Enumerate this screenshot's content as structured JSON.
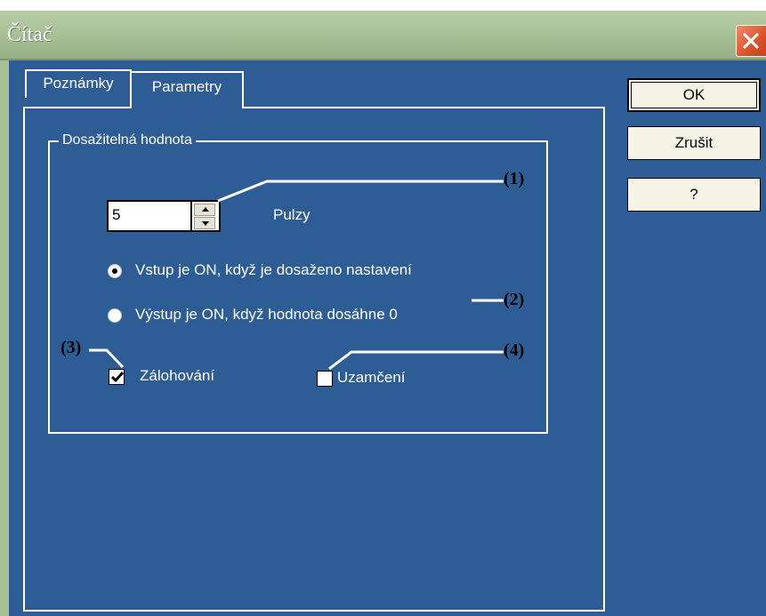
{
  "window": {
    "title": "Čítač"
  },
  "tabs": [
    {
      "label": "Poznámky",
      "active": false
    },
    {
      "label": "Parametry",
      "active": true
    }
  ],
  "group": {
    "label": "Dosažitelná hodnota"
  },
  "counter": {
    "value": "5",
    "unit_label": "Pulzy"
  },
  "radios": [
    {
      "label": "Vstup je ON, když je dosaženo nastavení",
      "checked": true
    },
    {
      "label": "Výstup je ON, když hodnota dosáhne 0",
      "checked": false
    }
  ],
  "checkboxes": [
    {
      "label": "Zálohování",
      "checked": true
    },
    {
      "label": "Uzamčení",
      "checked": false
    }
  ],
  "callouts": [
    "(1)",
    "(2)",
    "(3)",
    "(4)"
  ],
  "buttons": {
    "ok": "OK",
    "cancel": "Zrušit",
    "help": "?"
  },
  "colors": {
    "panel_bg": "#2e5d95",
    "titlebar": "#a9bf96",
    "close": "#d9532b"
  }
}
